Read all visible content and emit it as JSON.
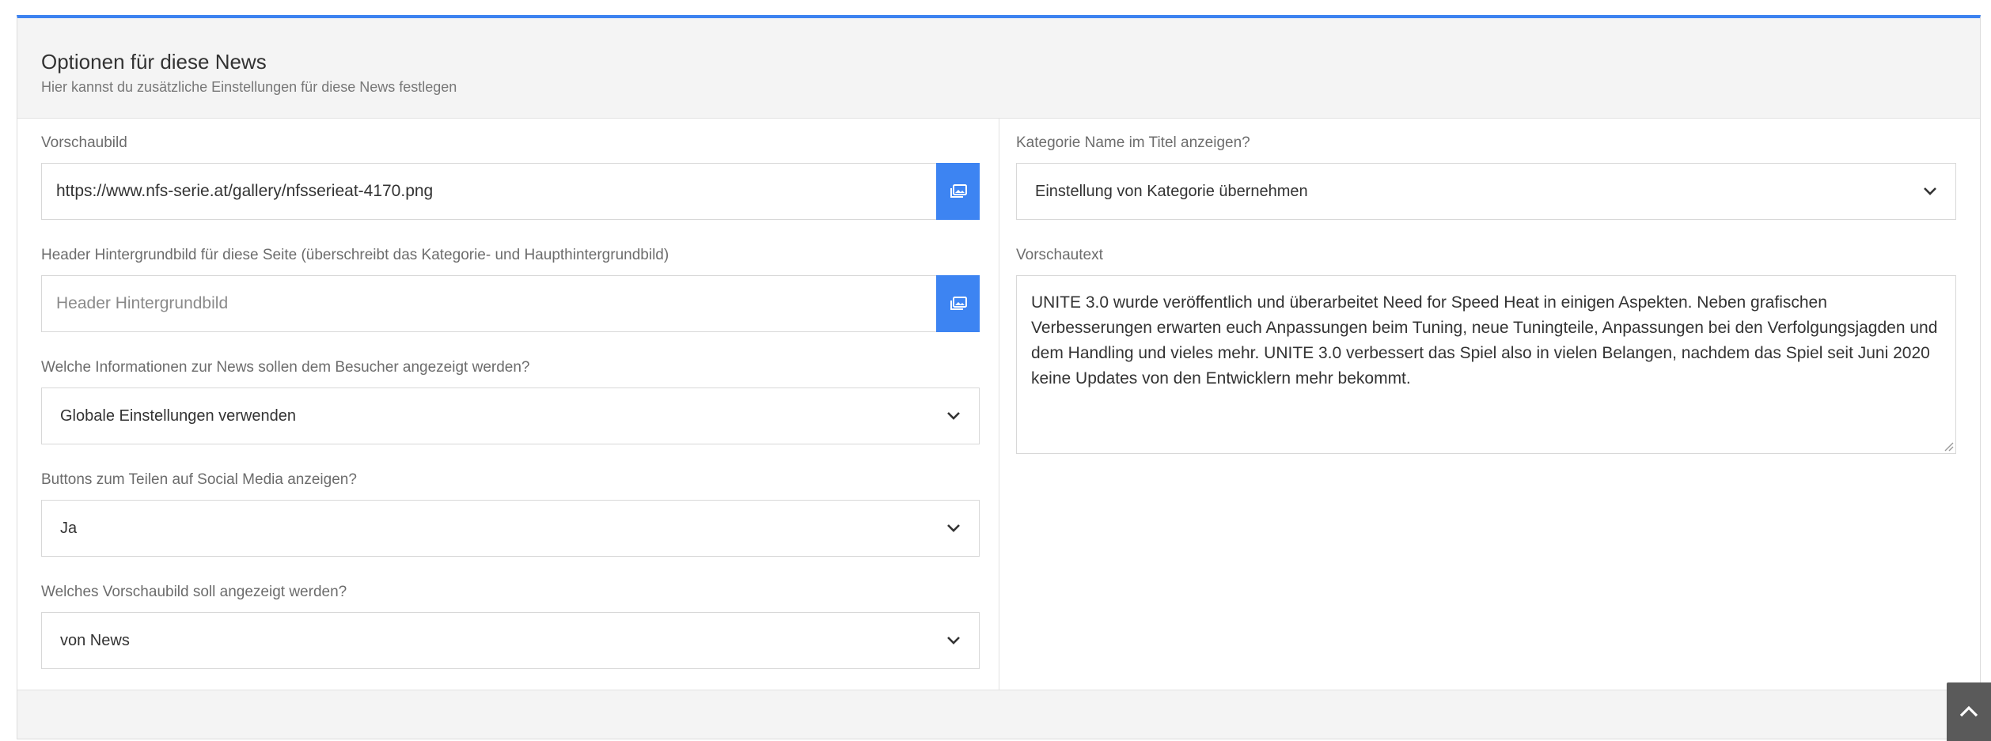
{
  "panel": {
    "title": "Optionen für diese News",
    "subtitle": "Hier kannst du zusätzliche Einstellungen für diese News festlegen"
  },
  "left": {
    "thumbnail": {
      "label": "Vorschaubild",
      "value": "https://www.nfs-serie.at/gallery/nfsserieat-4170.png",
      "button_icon": "image-icon"
    },
    "header_bg": {
      "label": "Header Hintergrundbild für diese Seite (überschreibt das Kategorie- und Haupthintergrundbild)",
      "placeholder": "Header Hintergrundbild",
      "value": "",
      "button_icon": "image-icon"
    },
    "info_display": {
      "label": "Welche Informationen zur News sollen dem Besucher angezeigt werden?",
      "selected": "Globale Einstellungen verwenden"
    },
    "social_buttons": {
      "label": "Buttons zum Teilen auf Social Media anzeigen?",
      "selected": "Ja"
    },
    "preview_image_source": {
      "label": "Welches Vorschaubild soll angezeigt werden?",
      "selected": "von News"
    }
  },
  "right": {
    "category_in_title": {
      "label": "Kategorie Name im Titel anzeigen?",
      "selected": "Einstellung von Kategorie übernehmen"
    },
    "preview_text": {
      "label": "Vorschautext",
      "value": "UNITE 3.0 wurde veröffentlich und überarbeitet Need for Speed Heat in einigen Aspekten. Neben grafischen Verbesserungen erwarten euch Anpassungen beim Tuning, neue Tuningteile, Anpassungen bei den Verfolgungsjagden und dem Handling und vieles mehr. UNITE 3.0 verbessert das Spiel also in vielen Belangen, nachdem das Spiel seit Juni 2020 keine Updates von den Entwicklern mehr bekommt."
    }
  },
  "scroll_top_icon": "chevron-up-icon",
  "colors": {
    "accent": "#3d84f2",
    "header_bg": "#f4f4f4",
    "scroll_button": "#5a5a5a"
  }
}
